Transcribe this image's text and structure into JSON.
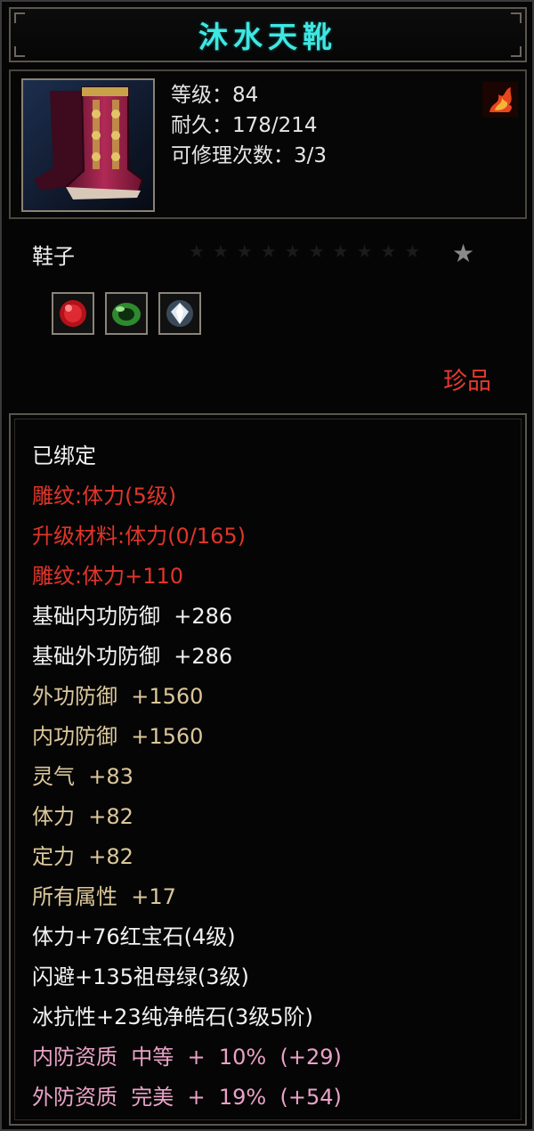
{
  "item": {
    "name": "沐水天靴",
    "level_line": "等级：84",
    "durability_line": "耐久：178/214",
    "repair_line": "可修理次数：3/3",
    "icon": "boots-icon",
    "badge_icon": "fire-emblem-icon",
    "type": "鞋子",
    "star_icon": "star-icon",
    "gems": [
      {
        "name": "ruby-gem-icon",
        "color": "#c8151b"
      },
      {
        "name": "emerald-gem-icon",
        "color": "#3fae3c"
      },
      {
        "name": "diamond-gem-icon",
        "color": "#c9d7e6"
      }
    ],
    "rarity": "珍品"
  },
  "attributes": [
    {
      "text": "已绑定",
      "color": "white"
    },
    {
      "text": "雕纹:体力(5级)",
      "color": "red"
    },
    {
      "text": "升级材料:体力(0/165)",
      "color": "red"
    },
    {
      "text": "雕纹:体力+110",
      "color": "red"
    },
    {
      "text": "基础内功防御  +286",
      "color": "white"
    },
    {
      "text": "基础外功防御  +286",
      "color": "white"
    },
    {
      "text": "外功防御  +1560",
      "color": "tan"
    },
    {
      "text": "内功防御  +1560",
      "color": "tan"
    },
    {
      "text": "灵气  +83",
      "color": "tan"
    },
    {
      "text": "体力  +82",
      "color": "tan"
    },
    {
      "text": "定力  +82",
      "color": "tan"
    },
    {
      "text": "所有属性  +17",
      "color": "tan"
    },
    {
      "text": "体力+76红宝石(4级)",
      "color": "white"
    },
    {
      "text": "闪避+135祖母绿(3级)",
      "color": "white"
    },
    {
      "text": "冰抗性+23纯净皓石(3级5阶)",
      "color": "white"
    },
    {
      "text": "内防资质  中等  +  10%  (+29)",
      "color": "pink"
    },
    {
      "text": "外防资质  完美  +  19%  (+54)",
      "color": "pink"
    }
  ],
  "colors": {
    "title": "#3fe7e2",
    "white": "#f2f2f2",
    "red": "#e0352a",
    "tan": "#dcc79a",
    "pink": "#e9a2c7",
    "rarity": "#e43a2e"
  }
}
